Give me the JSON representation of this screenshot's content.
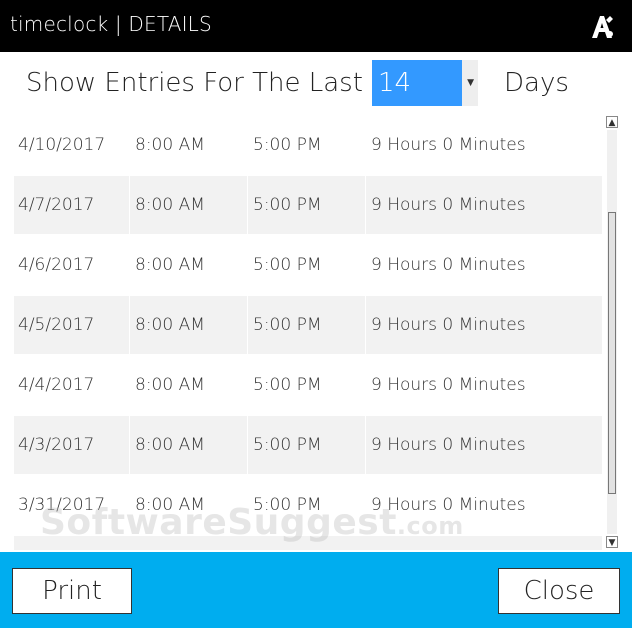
{
  "window": {
    "title": "timeclock | DETAILS",
    "logo_icon": "ampersand-logo-icon"
  },
  "filter": {
    "lead_label": "Show Entries For The Last",
    "selected_value": "14",
    "trail_label": "Days"
  },
  "entries": [
    {
      "date": "4/10/2017",
      "in": "8:00 AM",
      "out": "5:00 PM",
      "total": "9 Hours 0 Minutes"
    },
    {
      "date": "4/7/2017",
      "in": "8:00 AM",
      "out": "5:00 PM",
      "total": "9 Hours 0 Minutes"
    },
    {
      "date": "4/6/2017",
      "in": "8:00 AM",
      "out": "5:00 PM",
      "total": "9 Hours 0 Minutes"
    },
    {
      "date": "4/5/2017",
      "in": "8:00 AM",
      "out": "5:00 PM",
      "total": "9 Hours 0 Minutes"
    },
    {
      "date": "4/4/2017",
      "in": "8:00 AM",
      "out": "5:00 PM",
      "total": "9 Hours 0 Minutes"
    },
    {
      "date": "4/3/2017",
      "in": "8:00 AM",
      "out": "5:00 PM",
      "total": "9 Hours 0 Minutes"
    },
    {
      "date": "3/31/2017",
      "in": "8:00 AM",
      "out": "5:00 PM",
      "total": "9 Hours 0 Minutes"
    }
  ],
  "footer": {
    "print_label": "Print",
    "close_label": "Close"
  },
  "watermark": {
    "main": "SoftwareSuggest",
    "suffix": ".com"
  },
  "colors": {
    "titlebar": "#000000",
    "accent_select": "#3399ff",
    "footer": "#00adef",
    "row_alt": "#f2f2f2"
  }
}
